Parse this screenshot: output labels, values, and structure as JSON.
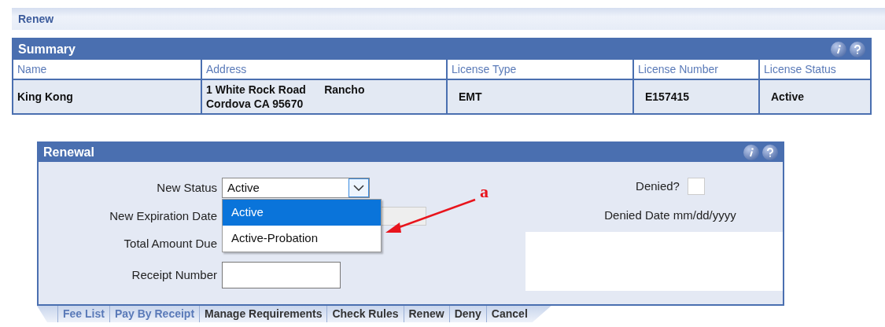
{
  "breadcrumb": {
    "title": "Renew"
  },
  "summary": {
    "title": "Summary",
    "columns": [
      "Name",
      "Address",
      "License Type",
      "License Number",
      "License Status"
    ],
    "rows": [
      [
        "King Kong",
        "1 White Rock Road      Rancho Cordova CA 95670",
        "EMT",
        "E157415",
        "Active"
      ]
    ]
  },
  "renewal": {
    "title": "Renewal",
    "new_status": {
      "label": "New Status",
      "value": "Active",
      "expanded": true,
      "options": [
        {
          "label": "Active",
          "selected": true
        },
        {
          "label": "Active-Probation",
          "selected": false
        }
      ]
    },
    "new_expiration_date": {
      "label": "New Expiration Date"
    },
    "total_amount_due": {
      "label": "Total Amount Due"
    },
    "receipt_number": {
      "label": "Receipt Number"
    },
    "denied": {
      "label": "Denied?",
      "checked": false
    },
    "denied_date": {
      "label": "Denied Date mm/dd/yyyy"
    },
    "actions": [
      {
        "label": "Fee List",
        "color": "#5a7ab8"
      },
      {
        "label": "Pay By Receipt",
        "color": "#5a7ab8"
      },
      {
        "label": "Manage Requirements",
        "color": "#333333"
      },
      {
        "label": "Check Rules",
        "color": "#333333"
      },
      {
        "label": "Renew",
        "color": "#333333"
      },
      {
        "label": "Deny",
        "color": "#333333"
      },
      {
        "label": "Cancel",
        "color": "#333333"
      }
    ]
  },
  "annotation": {
    "label": "a"
  }
}
